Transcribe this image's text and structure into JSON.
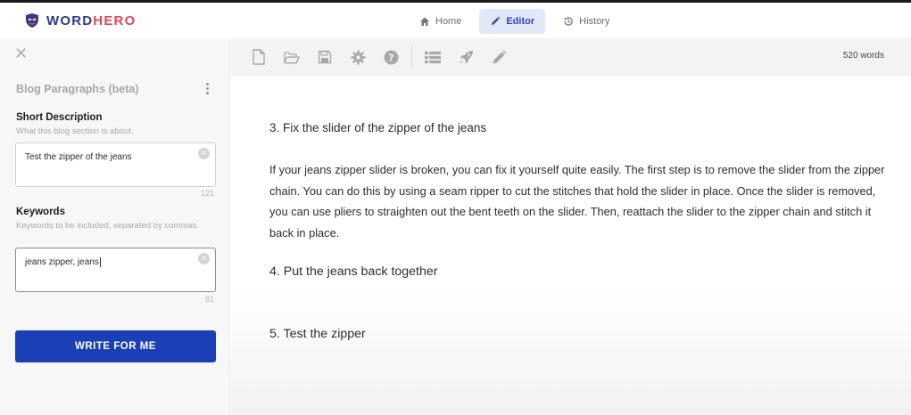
{
  "app": {
    "logo_word": "WORD",
    "logo_hero": "HERO"
  },
  "nav": {
    "items": [
      {
        "label": "Home",
        "icon": "home-icon"
      },
      {
        "label": "Editor",
        "icon": "pencil-icon",
        "active": true
      },
      {
        "label": "History",
        "icon": "history-icon"
      }
    ]
  },
  "sidebar": {
    "close_icon": "close-icon",
    "tool_title": "Blog Paragraphs (beta)",
    "short_description": {
      "label": "Short Description",
      "help": "What this blog section is about.",
      "value": "Test the zipper of the jeans",
      "counter": "121"
    },
    "keywords": {
      "label": "Keywords",
      "help": "Keywords to be included, separated by commas.",
      "value": "jeans zipper, jeans",
      "counter": "81"
    },
    "write_button": "WRITE FOR ME"
  },
  "toolbar": {
    "icons": [
      "new-document-icon",
      "open-folder-icon",
      "save-icon",
      "settings-icon",
      "help-icon",
      "list-icon",
      "rocket-icon",
      "pencil-icon"
    ],
    "word_count": "520 words"
  },
  "document": {
    "heading_3": "3. Fix the slider of the zipper of the jeans",
    "paragraph_3": "If your jeans zipper slider is broken, you can fix it yourself quite easily. The first step is to remove the slider from the zipper chain. You can do this by using a seam ripper to cut the stitches that hold the slider in place. Once the slider is removed, you can use pliers to straighten out the bent teeth on the slider. Then, reattach the slider to the zipper chain and stitch it back in place.",
    "heading_4": "4. Put the jeans back together",
    "heading_5": "5. Test the zipper"
  },
  "colors": {
    "brand_blue": "#1a3fb6",
    "logo_word": "#2d3a8c",
    "logo_hero": "#e0475c",
    "nav_active_bg": "#e3e8f6"
  }
}
